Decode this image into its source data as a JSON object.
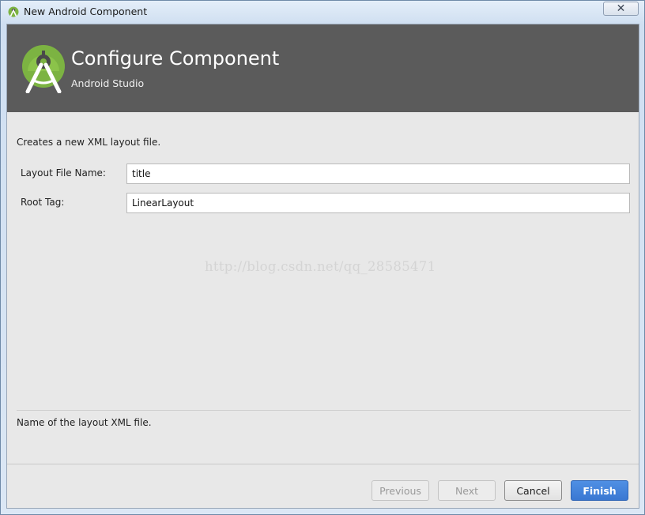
{
  "window": {
    "title": "New Android Component",
    "close_glyph": "✕"
  },
  "header": {
    "title": "Configure Component",
    "subtitle": "Android Studio",
    "logo_icon": "android-studio-logo",
    "logo_color": "#7cb342"
  },
  "form": {
    "description": "Creates a new XML layout file.",
    "fields": [
      {
        "label": "Layout File Name:",
        "value": "title"
      },
      {
        "label": "Root Tag:",
        "value": "LinearLayout"
      }
    ]
  },
  "watermark": "http://blog.csdn.net/qq_28585471",
  "help_text": "Name of the layout XML file.",
  "buttons": {
    "previous": "Previous",
    "next": "Next",
    "cancel": "Cancel",
    "finish": "Finish"
  },
  "colors": {
    "header_bg": "#5b5b5b",
    "primary_button": "#3a78d2"
  }
}
